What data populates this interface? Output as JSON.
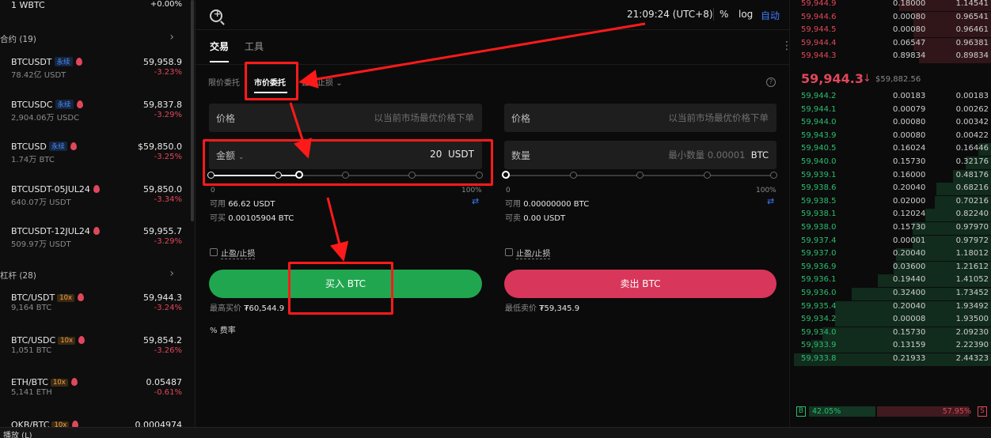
{
  "left_panel": {
    "top_row": {
      "symbol": "1 WBTC",
      "change": "+0.00%"
    },
    "section_contracts": "合约 (19)",
    "section_margin": "杠杆 (28)",
    "contracts": [
      {
        "symbol": "BTCUSDT",
        "tag": "永续",
        "volume": "78.42亿 USDT",
        "price": "59,958.9",
        "change": "-3.23%"
      },
      {
        "symbol": "BTCUSDC",
        "tag": "永续",
        "volume": "2,904.06万 USDC",
        "price": "59,837.8",
        "change": "-3.29%"
      },
      {
        "symbol": "BTCUSD",
        "tag": "永续",
        "volume": "1.74万 BTC",
        "price": "$59,850.0",
        "change": "-3.25%"
      },
      {
        "symbol": "BTCUSDT-05JUL24",
        "tag": "",
        "volume": "640.07万 USDT",
        "price": "59,850.0",
        "change": "-3.34%"
      },
      {
        "symbol": "BTCUSDT-12JUL24",
        "tag": "",
        "volume": "509.97万 USDT",
        "price": "59,955.7",
        "change": "-3.29%"
      }
    ],
    "margin": [
      {
        "symbol": "BTC/USDT",
        "tag": "10x",
        "volume": "9,164 BTC",
        "price": "59,944.3",
        "change": "-3.24%"
      },
      {
        "symbol": "BTC/USDC",
        "tag": "10x",
        "volume": "1,051 BTC",
        "price": "59,854.2",
        "change": "-3.26%"
      },
      {
        "symbol": "ETH/BTC",
        "tag": "10x",
        "volume": "5,141 ETH",
        "price": "0.05487",
        "change": "-0.61%"
      },
      {
        "symbol": "OKB/BTC",
        "tag": "10x",
        "volume": "",
        "price": "0.0004974",
        "change": ""
      }
    ]
  },
  "toolbar": {
    "clock": "21:09:24 (UTC+8)",
    "percent": "%",
    "log": "log",
    "auto": "自动"
  },
  "tabs": {
    "trade": "交易",
    "tools": "工具"
  },
  "order_types": {
    "limit": "限价委托",
    "market": "市价委托",
    "stop": "止盈止损"
  },
  "buy_form": {
    "price_label": "价格",
    "price_placeholder": "以当前市场最优价格下单",
    "amount_label": "金额",
    "amount_value": "20",
    "amount_unit": "USDT",
    "slider_min": "0",
    "slider_max": "100%",
    "slider_value_pct": 33,
    "available_label": "可用",
    "available_value": "66.62 USDT",
    "can_buy_label": "可买",
    "can_buy_value": "0.00105904 BTC",
    "tpsl_label": "止盈/止损",
    "button": "买入 BTC",
    "max_price_label": "最高买价",
    "max_price_value": "₮60,544.9",
    "fee_label": "费率"
  },
  "sell_form": {
    "price_label": "价格",
    "price_placeholder": "以当前市场最优价格下单",
    "qty_label": "数量",
    "qty_placeholder": "最小数量 0.00001",
    "qty_unit": "BTC",
    "slider_min": "0",
    "slider_max": "100%",
    "slider_value_pct": 0,
    "available_label": "可用",
    "available_value": "0.00000000 BTC",
    "can_sell_label": "可卖",
    "can_sell_value": "0.00 USDT",
    "tpsl_label": "止盈/止损",
    "button": "卖出 BTC",
    "min_price_label": "最低卖价",
    "min_price_value": "₮59,345.9"
  },
  "order_book": {
    "asks": [
      {
        "price": "59,944.9",
        "qty": "0.18000",
        "total": "1.14541"
      },
      {
        "price": "59,944.6",
        "qty": "0.00080",
        "total": "0.96541"
      },
      {
        "price": "59,944.5",
        "qty": "0.00080",
        "total": "0.96461"
      },
      {
        "price": "59,944.4",
        "qty": "0.06547",
        "total": "0.96381"
      },
      {
        "price": "59,944.3",
        "qty": "0.89834",
        "total": "0.89834"
      }
    ],
    "mid_price": "59,944.3",
    "mid_arrow": "↓",
    "mid_fiat": "$59,882.56",
    "bids": [
      {
        "price": "59,944.2",
        "qty": "0.00183",
        "total": "0.00183"
      },
      {
        "price": "59,944.1",
        "qty": "0.00079",
        "total": "0.00262"
      },
      {
        "price": "59,944.0",
        "qty": "0.00080",
        "total": "0.00342"
      },
      {
        "price": "59,943.9",
        "qty": "0.00080",
        "total": "0.00422"
      },
      {
        "price": "59,940.5",
        "qty": "0.16024",
        "total": "0.16446"
      },
      {
        "price": "59,940.0",
        "qty": "0.15730",
        "total": "0.32176"
      },
      {
        "price": "59,939.1",
        "qty": "0.16000",
        "total": "0.48176"
      },
      {
        "price": "59,938.6",
        "qty": "0.20040",
        "total": "0.68216"
      },
      {
        "price": "59,938.5",
        "qty": "0.02000",
        "total": "0.70216"
      },
      {
        "price": "59,938.1",
        "qty": "0.12024",
        "total": "0.82240"
      },
      {
        "price": "59,938.0",
        "qty": "0.15730",
        "total": "0.97970"
      },
      {
        "price": "59,937.4",
        "qty": "0.00001",
        "total": "0.97972"
      },
      {
        "price": "59,937.0",
        "qty": "0.20040",
        "total": "1.18012"
      },
      {
        "price": "59,936.9",
        "qty": "0.03600",
        "total": "1.21612"
      },
      {
        "price": "59,936.1",
        "qty": "0.19440",
        "total": "1.41052"
      },
      {
        "price": "59,936.0",
        "qty": "0.32400",
        "total": "1.73452"
      },
      {
        "price": "59,935.4",
        "qty": "0.20040",
        "total": "1.93492"
      },
      {
        "price": "59,934.2",
        "qty": "0.00008",
        "total": "1.93500"
      },
      {
        "price": "59,934.0",
        "qty": "0.15730",
        "total": "2.09230"
      },
      {
        "price": "59,933.9",
        "qty": "0.13159",
        "total": "2.22390"
      },
      {
        "price": "59,933.8",
        "qty": "0.21933",
        "total": "2.44323"
      }
    ],
    "buy_ratio": "42.05%",
    "sell_ratio": "57.95%",
    "buy_letter": "B",
    "sell_letter": "S"
  },
  "bottom_strip": "播放 (L)",
  "colors": {
    "buy": "#21a650",
    "sell": "#d8365a",
    "accent": "#3d7cff",
    "annotation": "#ff1a1a"
  }
}
